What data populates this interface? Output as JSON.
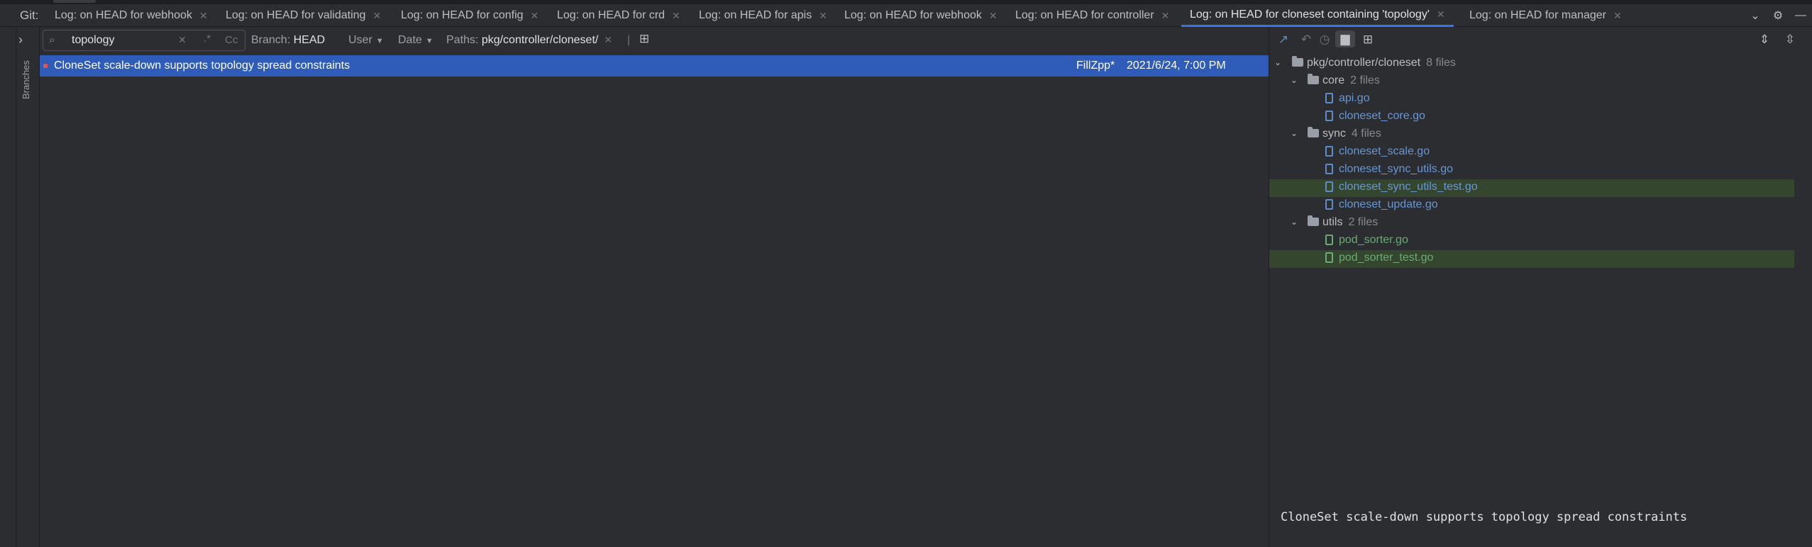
{
  "tabbar": {
    "git_label": "Git:",
    "tabs": [
      {
        "label": "Log: on HEAD for webhook",
        "active": false
      },
      {
        "label": "Log: on HEAD for validating",
        "active": false
      },
      {
        "label": "Log: on HEAD for config",
        "active": false
      },
      {
        "label": "Log: on HEAD for crd",
        "active": false
      },
      {
        "label": "Log: on HEAD for apis",
        "active": false
      },
      {
        "label": "Log: on HEAD for webhook",
        "active": false
      },
      {
        "label": "Log: on HEAD for controller",
        "active": false
      },
      {
        "label": "Log: on HEAD for cloneset containing 'topology'",
        "active": true
      },
      {
        "label": "Log: on HEAD for manager",
        "active": false
      }
    ],
    "right_icons": [
      "chevron-down-icon",
      "gear-icon",
      "minimize-icon"
    ]
  },
  "sidebar": {
    "label": "Branches"
  },
  "filters": {
    "search_value": "topology",
    "regex_label": ".*",
    "case_label": "Cc",
    "branch_label": "Branch:",
    "branch_value": "HEAD",
    "user_label": "User",
    "date_label": "Date",
    "paths_label": "Paths:",
    "paths_value": "pkg/controller/cloneset/"
  },
  "commits": [
    {
      "message": "CloneSet scale-down supports topology spread constraints",
      "author": "FillZpp*",
      "date": "2021/6/24, 7:00 PM",
      "selected": true
    }
  ],
  "right_toolbar_icons": [
    "diff-icon",
    "revert-icon",
    "history-icon",
    "folder-icon",
    "group-icon",
    "expand-all-icon",
    "collapse-all-icon"
  ],
  "tree": {
    "root": {
      "name": "pkg/controller/cloneset",
      "count": "8 files"
    },
    "folders": [
      {
        "name": "core",
        "count": "2 files",
        "files": [
          {
            "name": "api.go",
            "status": "modified"
          },
          {
            "name": "cloneset_core.go",
            "status": "modified"
          }
        ]
      },
      {
        "name": "sync",
        "count": "4 files",
        "files": [
          {
            "name": "cloneset_scale.go",
            "status": "modified"
          },
          {
            "name": "cloneset_sync_utils.go",
            "status": "modified"
          },
          {
            "name": "cloneset_sync_utils_test.go",
            "status": "modified"
          },
          {
            "name": "cloneset_update.go",
            "status": "modified"
          }
        ]
      },
      {
        "name": "utils",
        "count": "2 files",
        "files": [
          {
            "name": "pod_sorter.go",
            "status": "added"
          },
          {
            "name": "pod_sorter_test.go",
            "status": "added"
          }
        ]
      }
    ]
  },
  "details": {
    "message": "CloneSet scale-down supports topology spread constraints"
  },
  "colors": {
    "accent": "#3574f0",
    "selection": "#2e5cb8",
    "modified": "#6897d4",
    "added": "#6aab73"
  }
}
